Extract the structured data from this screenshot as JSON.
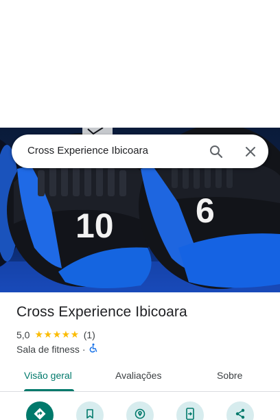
{
  "search": {
    "query": "Cross Experience Ibicoara"
  },
  "hero": {
    "ball_left_number": "10",
    "ball_right_number": "6"
  },
  "place": {
    "name": "Cross Experience Ibicoara",
    "rating": "5,0",
    "stars": "★★★★★",
    "review_count": "(1)",
    "category": "Sala de fitness",
    "separator": "·"
  },
  "tabs": [
    {
      "label": "Visão geral",
      "active": true
    },
    {
      "label": "Avaliações",
      "active": false
    },
    {
      "label": "Sobre",
      "active": false
    }
  ],
  "actions": [
    {
      "icon": "directions-icon"
    },
    {
      "icon": "bookmark-icon"
    },
    {
      "icon": "nearby-icon"
    },
    {
      "icon": "send-to-phone-icon"
    },
    {
      "icon": "share-icon"
    }
  ],
  "colors": {
    "accent": "#00796b",
    "action_bg": "#d7ecee",
    "star": "#fbbc04",
    "wheelchair": "#1a73e8"
  }
}
